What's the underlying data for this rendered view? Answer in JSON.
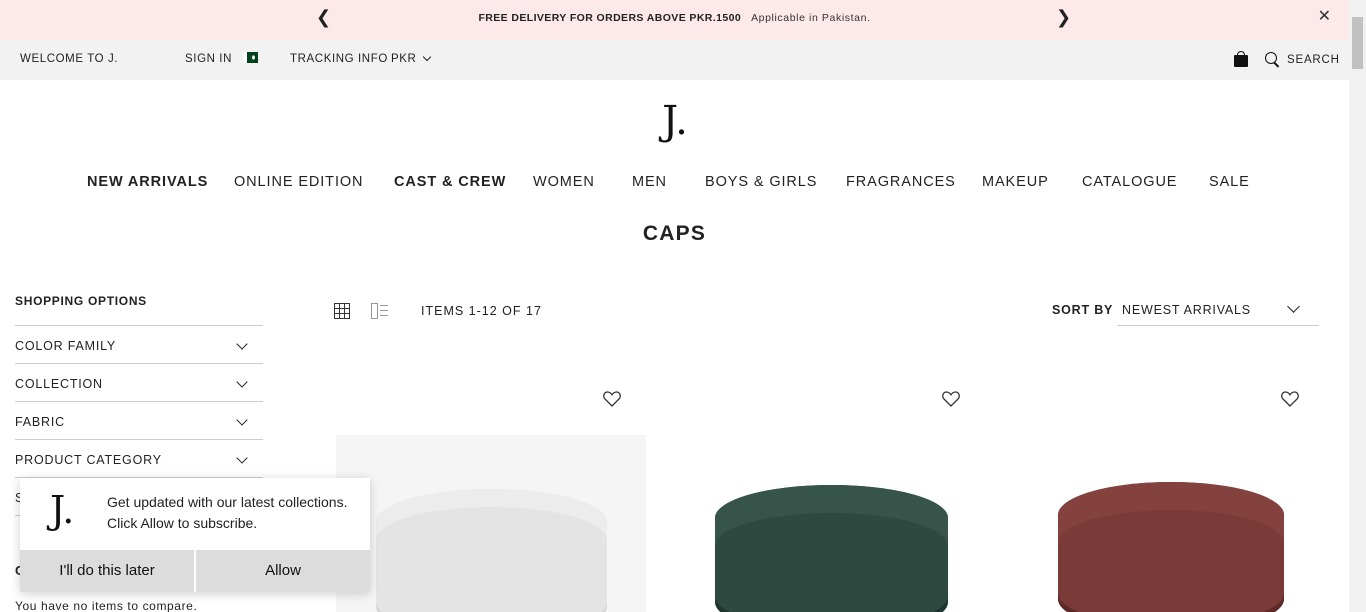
{
  "promo": {
    "message_bold": "FREE DELIVERY FOR ORDERS ABOVE PKR.1500",
    "message_sub": "Applicable in Pakistan.",
    "prev_icon": "chevron-left-icon",
    "next_icon": "chevron-right-icon",
    "close_icon": "close-icon"
  },
  "utility": {
    "welcome": "WELCOME TO J.",
    "sign_in": "SIGN IN",
    "tracking": "TRACKING INFO",
    "currency": "PKR",
    "search": "SEARCH"
  },
  "logo": "J.",
  "nav": [
    {
      "label": "NEW ARRIVALS"
    },
    {
      "label": "ONLINE EDITION"
    },
    {
      "label": "CAST & CREW"
    },
    {
      "label": "WOMEN"
    },
    {
      "label": "MEN"
    },
    {
      "label": "BOYS & GIRLS"
    },
    {
      "label": "FRAGRANCES"
    },
    {
      "label": "MAKEUP"
    },
    {
      "label": "CATALOGUE"
    },
    {
      "label": "SALE"
    }
  ],
  "page_title": "CAPS",
  "sidebar": {
    "heading": "SHOPPING OPTIONS",
    "filters": [
      {
        "label": "COLOR FAMILY"
      },
      {
        "label": "COLLECTION"
      },
      {
        "label": "FABRIC"
      },
      {
        "label": "PRODUCT CATEGORY"
      },
      {
        "label": "S"
      }
    ],
    "compare_heading": "C",
    "compare_text": "You have no items to compare."
  },
  "toolbar": {
    "items_count": "ITEMS 1-12 OF 17",
    "sort_label": "SORT BY",
    "sort_value": "NEWEST ARRIVALS"
  },
  "products": [
    {
      "color": "#e6e6e6",
      "shade": "#cfcfcf",
      "faded": true
    },
    {
      "color": "#2e4a40",
      "shade": "#1f3630",
      "faded": false
    },
    {
      "color": "#7a3a38",
      "shade": "#5e2a29",
      "faded": false
    }
  ],
  "popup": {
    "logo": "J.",
    "text": "Get updated with our latest collections. Click Allow to subscribe.",
    "later": "I'll do this later",
    "allow": "Allow"
  }
}
